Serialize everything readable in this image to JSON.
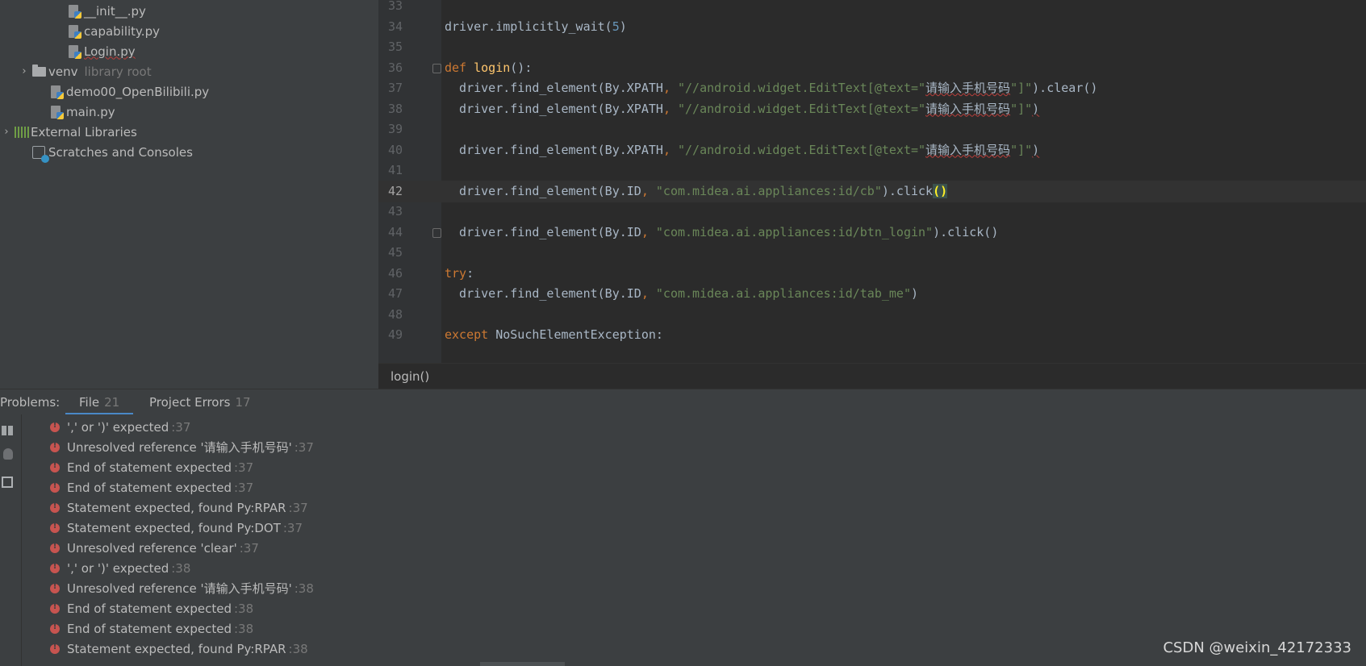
{
  "project_tree": [
    {
      "label": "__init__.py",
      "type": "py",
      "indent": 3
    },
    {
      "label": "capability.py",
      "type": "py",
      "indent": 3
    },
    {
      "label": "Login.py",
      "type": "py",
      "indent": 3,
      "error": true
    },
    {
      "label": "venv",
      "suffix": "library root",
      "type": "folder",
      "indent": 1,
      "arrow": "›"
    },
    {
      "label": "demo00_OpenBilibili.py",
      "type": "py",
      "indent": 2
    },
    {
      "label": "main.py",
      "type": "py",
      "indent": 2
    },
    {
      "label": "External Libraries",
      "type": "libs",
      "indent": 0,
      "arrow": "›"
    },
    {
      "label": "Scratches and Consoles",
      "type": "scratch",
      "indent": 1
    }
  ],
  "editor": {
    "current_line": "42",
    "lines": [
      {
        "n": "33",
        "t": []
      },
      {
        "n": "34",
        "t": [
          [
            "cn",
            "driver.implicitly_wait("
          ],
          [
            "num",
            "5"
          ],
          [
            "cn",
            ")"
          ]
        ]
      },
      {
        "n": "35",
        "t": []
      },
      {
        "n": "36",
        "fold": true,
        "t": [
          [
            "kw",
            "def "
          ],
          [
            "fn",
            "login"
          ],
          [
            "cn",
            "():"
          ]
        ]
      },
      {
        "n": "37",
        "t": [
          [
            "cn",
            "  driver.find_element(By.XPATH"
          ],
          [
            "kw",
            ", "
          ],
          [
            "str",
            "\"//android.widget.EditText[@text=\""
          ],
          [
            "cnw",
            "请输入手机号码"
          ],
          [
            "str",
            "\"]\""
          ],
          [
            "cn",
            ").clear()"
          ]
        ]
      },
      {
        "n": "38",
        "t": [
          [
            "cn",
            "  driver.find_element(By.XPATH"
          ],
          [
            "kw",
            ", "
          ],
          [
            "str",
            "\"//android.widget.EditText[@text=\""
          ],
          [
            "cnw",
            "请输入手机号码"
          ],
          [
            "str",
            "\"]\""
          ],
          [
            "cnw",
            ")"
          ]
        ]
      },
      {
        "n": "39",
        "t": []
      },
      {
        "n": "40",
        "t": [
          [
            "cn",
            "  driver.find_element(By.XPATH"
          ],
          [
            "kw",
            ", "
          ],
          [
            "str",
            "\"//android.widget.EditText[@text=\""
          ],
          [
            "cnw",
            "请输入手机号码"
          ],
          [
            "str",
            "\"]\""
          ],
          [
            "cnw",
            ")"
          ]
        ]
      },
      {
        "n": "41",
        "t": []
      },
      {
        "n": "42",
        "t": [
          [
            "cn",
            "  driver.find_element(By.ID"
          ],
          [
            "kw",
            ", "
          ],
          [
            "str",
            "\"com.midea.ai.appliances:id/cb\""
          ],
          [
            "cn",
            ").click"
          ],
          [
            "hl",
            "()"
          ]
        ]
      },
      {
        "n": "43",
        "t": []
      },
      {
        "n": "44",
        "fold": true,
        "t": [
          [
            "cn",
            "  driver.find_element(By.ID"
          ],
          [
            "kw",
            ", "
          ],
          [
            "str",
            "\"com.midea.ai.appliances:id/btn_login\""
          ],
          [
            "cn",
            ").click()"
          ]
        ]
      },
      {
        "n": "45",
        "t": []
      },
      {
        "n": "46",
        "t": [
          [
            "kw",
            "try"
          ],
          [
            "cn",
            ":"
          ]
        ]
      },
      {
        "n": "47",
        "t": [
          [
            "cn",
            "  driver.find_element(By.ID"
          ],
          [
            "kw",
            ", "
          ],
          [
            "str",
            "\"com.midea.ai.appliances:id/tab_me\""
          ],
          [
            "cn",
            ")"
          ]
        ]
      },
      {
        "n": "48",
        "t": []
      },
      {
        "n": "49",
        "t": [
          [
            "kw",
            "except "
          ],
          [
            "cn",
            "NoSuchElementException:"
          ]
        ]
      }
    ]
  },
  "breadcrumb": "login()",
  "problems": {
    "title": "Problems:",
    "tabs": [
      {
        "label": "File",
        "count": "21",
        "active": true
      },
      {
        "label": "Project Errors",
        "count": "17",
        "active": false
      }
    ],
    "items": [
      {
        "msg": "',' or ')' expected",
        "loc": ":37"
      },
      {
        "msg": "Unresolved reference '请输入手机号码'",
        "loc": ":37"
      },
      {
        "msg": "End of statement expected",
        "loc": ":37"
      },
      {
        "msg": "End of statement expected",
        "loc": ":37"
      },
      {
        "msg": "Statement expected, found Py:RPAR",
        "loc": ":37"
      },
      {
        "msg": "Statement expected, found Py:DOT",
        "loc": ":37"
      },
      {
        "msg": "Unresolved reference 'clear'",
        "loc": ":37"
      },
      {
        "msg": "',' or ')' expected",
        "loc": ":38"
      },
      {
        "msg": "Unresolved reference '请输入手机号码'",
        "loc": ":38"
      },
      {
        "msg": "End of statement expected",
        "loc": ":38"
      },
      {
        "msg": "End of statement expected",
        "loc": ":38"
      },
      {
        "msg": "Statement expected, found Py:RPAR",
        "loc": ":38"
      }
    ]
  },
  "watermark": "CSDN @weixin_42172333",
  "colors": {
    "error": "#c75450",
    "accent": "#4a88c7",
    "string": "#6a8759",
    "keyword": "#cc7832",
    "function": "#ffc66d"
  }
}
